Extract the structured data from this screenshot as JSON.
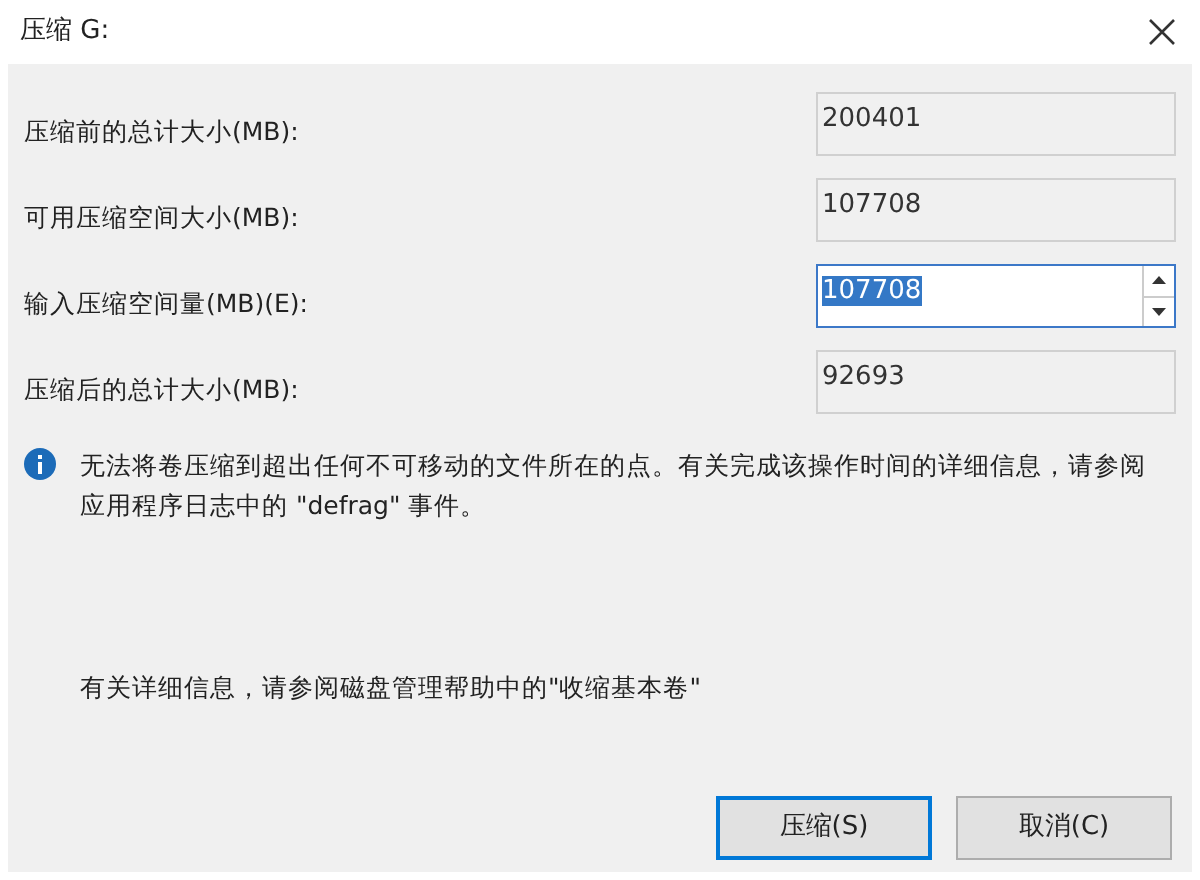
{
  "window": {
    "title": "压缩 G:"
  },
  "fields": [
    {
      "label": "压缩前的总计大小(MB):",
      "value": "200401",
      "kind": "readonly"
    },
    {
      "label": "可用压缩空间大小(MB):",
      "value": "107708",
      "kind": "readonly"
    },
    {
      "label": "输入压缩空间量(MB)(E):",
      "value": "107708",
      "kind": "spinner",
      "text_selected": true
    },
    {
      "label": "压缩后的总计大小(MB):",
      "value": "92693",
      "kind": "readonly"
    }
  ],
  "info": "无法将卷压缩到超出任何不可移动的文件所在的点。有关完成该操作时间的详细信息，请参阅应用程序日志中的 \"defrag\" 事件。",
  "help": "有关详细信息，请参阅磁盘管理帮助中的\"收缩基本卷\"",
  "buttons": [
    {
      "label": "压缩(S)",
      "default": true
    },
    {
      "label": "取消(C)",
      "default": false
    }
  ]
}
